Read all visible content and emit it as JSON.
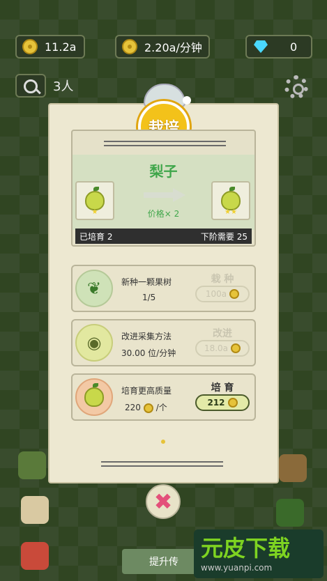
{
  "stats": {
    "coins": "11.2a",
    "rate": "2.20a/分钟",
    "gems": "0"
  },
  "people": "3人",
  "panel": {
    "badge": "栽培",
    "fruit_name": "梨子",
    "price": "价格× 2",
    "cultivated": "已培育 2",
    "next_need": "下阶需要 25",
    "rows": [
      {
        "title": "新种一颗果树",
        "sub": "1/5",
        "action": "栽 种",
        "cost": "100a"
      },
      {
        "title": "改进采集方法",
        "sub": "30.00 位/分钟",
        "action": "改进",
        "cost": "18.0a"
      },
      {
        "title": "培育更高质量",
        "sub": "220",
        "sub_unit": "/个",
        "action": "培 育",
        "cost": "212"
      }
    ]
  },
  "bottom_button": "提升传",
  "watermark": {
    "brand": "元皮下载",
    "url": "www.yuanpi.com"
  }
}
